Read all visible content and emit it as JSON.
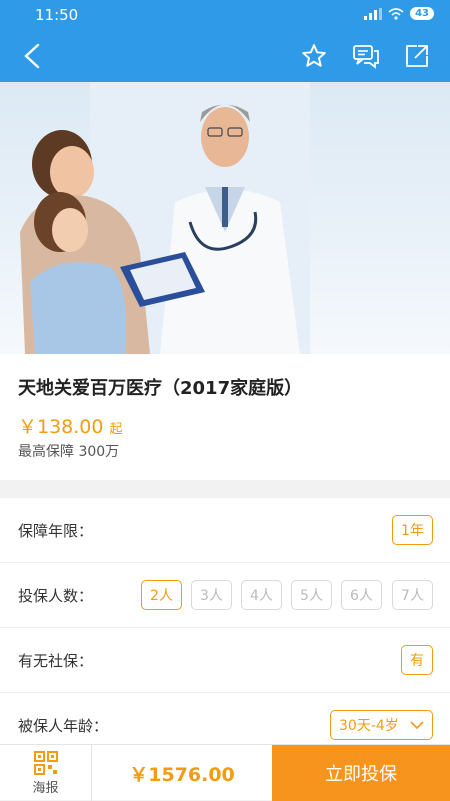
{
  "status_bar": {
    "time": "11:50",
    "battery": "43"
  },
  "header": {
    "back_icon": "back-arrow-icon",
    "icons": [
      "star-icon",
      "message-icon",
      "share-icon"
    ]
  },
  "product": {
    "title": "天地关爱百万医疗（2017家庭版）",
    "price": "￥138.00",
    "price_suffix": "起",
    "coverage": "最高保障 300万"
  },
  "options": {
    "term": {
      "label": "保障年限：",
      "value": "1年"
    },
    "people": {
      "label": "投保人数：",
      "choices": [
        "2人",
        "3人",
        "4人",
        "5人",
        "6人",
        "7人"
      ],
      "selected": "2人"
    },
    "social": {
      "label": "有无社保：",
      "value": "有"
    },
    "age": {
      "label": "被保人年龄：",
      "value": "30天-4岁"
    }
  },
  "bottom_bar": {
    "poster_label": "海报",
    "total": "￥1576.00",
    "buy_label": "立即投保"
  },
  "colors": {
    "primary": "#2f9be8",
    "accent": "#f39c12",
    "buy": "#f7941d"
  }
}
